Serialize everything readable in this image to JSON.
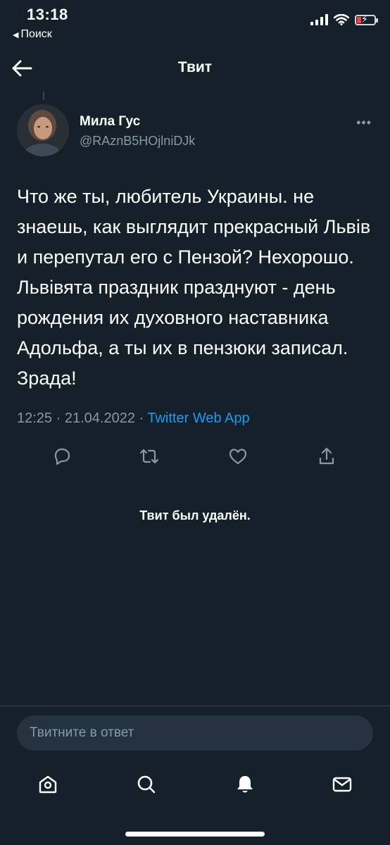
{
  "status_bar": {
    "time": "13:18",
    "back_app": "Поиск",
    "battery_state": "low-charging",
    "battery_color": "#ff4040"
  },
  "header": {
    "title": "Твит",
    "back_icon": "arrow-left-icon"
  },
  "tweet": {
    "author_name": "Мила Гус",
    "author_handle": "@RAznB5HOjlniDJk",
    "more_label": "•••",
    "text": "Что же ты, любитель Украины. не знаешь, как выглядит прекрасный Львів и перепутал его с Пензой? Нехорошо. Львівята праздник празднуют - день рождения их духовного наставника Адольфа, а ты их в пензюки записал. Зрада!",
    "time": "12:25",
    "separator": " · ",
    "date": "21.04.2022",
    "source": "Twitter Web App",
    "actions": [
      "reply-icon",
      "retweet-icon",
      "like-icon",
      "share-icon"
    ]
  },
  "deleted_notice": "Твит был удалён.",
  "reply": {
    "placeholder": "Твитните в ответ"
  },
  "tab_bar": {
    "items": [
      "home-icon",
      "search-icon",
      "notifications-icon",
      "messages-icon"
    ]
  },
  "colors": {
    "background": "#15202b",
    "secondary_text": "#8899a6",
    "accent": "#1d9bf0",
    "divider": "#38444d"
  }
}
